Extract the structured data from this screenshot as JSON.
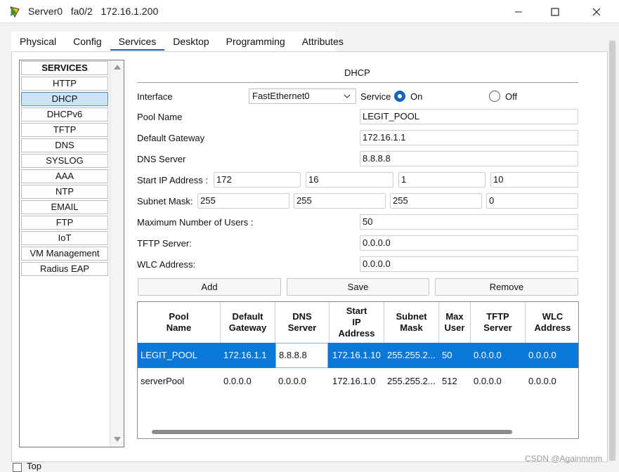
{
  "window": {
    "title": "Server0   fa0/2   172.16.1.200",
    "controls": [
      "minimize",
      "maximize",
      "close"
    ]
  },
  "tabs": [
    {
      "label": "Physical"
    },
    {
      "label": "Config"
    },
    {
      "label": "Services",
      "active": true
    },
    {
      "label": "Desktop"
    },
    {
      "label": "Programming"
    },
    {
      "label": "Attributes"
    }
  ],
  "services": {
    "header": "SERVICES",
    "items": [
      "HTTP",
      "DHCP",
      "DHCPv6",
      "TFTP",
      "DNS",
      "SYSLOG",
      "AAA",
      "NTP",
      "EMAIL",
      "FTP",
      "IoT",
      "VM Management",
      "Radius EAP"
    ],
    "active": "DHCP"
  },
  "dhcp": {
    "title": "DHCP",
    "interface_label": "Interface",
    "interface_value": "FastEthernet0",
    "service_label": "Service",
    "on_label": "On",
    "off_label": "Off",
    "service_state": "On",
    "pool_name_label": "Pool Name",
    "pool_name": "LEGIT_POOL",
    "gateway_label": "Default Gateway",
    "gateway": "172.16.1.1",
    "dns_label": "DNS Server",
    "dns": "8.8.8.8",
    "start_ip_label": "Start IP Address :",
    "start_ip": [
      "172",
      "16",
      "1",
      "10"
    ],
    "subnet_label": "Subnet Mask:",
    "subnet": [
      "255",
      "255",
      "255",
      "0"
    ],
    "max_users_label": "Maximum Number of Users :",
    "max_users": "50",
    "tftp_label": "TFTP Server:",
    "tftp": "0.0.0.0",
    "wlc_label": "WLC Address:",
    "wlc": "0.0.0.0",
    "buttons": {
      "add": "Add",
      "save": "Save",
      "remove": "Remove"
    }
  },
  "table": {
    "columns": [
      "Pool\nName",
      "Default\nGateway",
      "DNS\nServer",
      "Start\nIP\nAddress",
      "Subnet\nMask",
      "Max\nUser",
      "TFTP\nServer",
      "WLC\nAddress"
    ],
    "rows": [
      [
        "LEGIT_POOL",
        "172.16.1.1",
        "8.8.8.8",
        "172.16.1.10",
        "255.255.2...",
        "50",
        "0.0.0.0",
        "0.0.0.0"
      ],
      [
        "serverPool",
        "0.0.0.0",
        "0.0.0.0",
        "172.16.1.0",
        "255.255.2...",
        "512",
        "0.0.0.0",
        "0.0.0.0"
      ]
    ],
    "selected_row": 0
  },
  "footer": {
    "top_label": "Top",
    "watermark": "CSDN @Againmmm"
  },
  "colors": {
    "accent": "#1565c0",
    "selection": "#0a78d7",
    "tab_underline": "#1e5fa8"
  }
}
